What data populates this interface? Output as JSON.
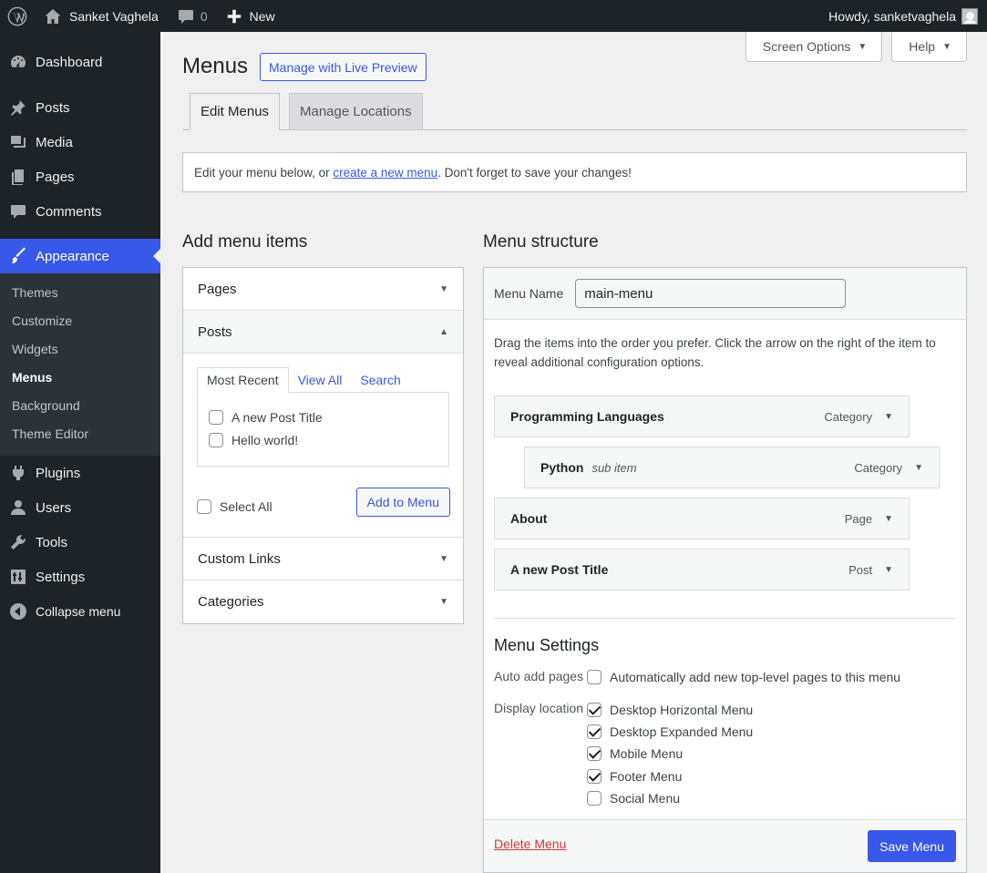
{
  "admin_bar": {
    "site_name": "Sanket Vaghela",
    "comments_count": "0",
    "new_label": "New",
    "greeting": "Howdy, sanketvaghela"
  },
  "sidebar": {
    "items": [
      {
        "label": "Dashboard",
        "icon": "dashboard-icon"
      },
      {
        "label": "Posts",
        "icon": "pin-icon"
      },
      {
        "label": "Media",
        "icon": "media-icon"
      },
      {
        "label": "Pages",
        "icon": "pages-icon"
      },
      {
        "label": "Comments",
        "icon": "comment-icon"
      },
      {
        "label": "Appearance",
        "icon": "brush-icon"
      },
      {
        "label": "Plugins",
        "icon": "plug-icon"
      },
      {
        "label": "Users",
        "icon": "user-icon"
      },
      {
        "label": "Tools",
        "icon": "wrench-icon"
      },
      {
        "label": "Settings",
        "icon": "sliders-icon"
      },
      {
        "label": "Collapse menu",
        "icon": "collapse-icon"
      }
    ],
    "submenu": [
      "Themes",
      "Customize",
      "Widgets",
      "Menus",
      "Background",
      "Theme Editor"
    ]
  },
  "header": {
    "screen_options": "Screen Options",
    "help": "Help",
    "title": "Menus",
    "live_preview": "Manage with Live Preview",
    "tabs": [
      "Edit Menus",
      "Manage Locations"
    ]
  },
  "notice": {
    "before": "Edit your menu below, or ",
    "link": "create a new menu",
    "after": ". Don't forget to save your changes!"
  },
  "add_items": {
    "title": "Add menu items",
    "sections": [
      "Pages",
      "Posts",
      "Custom Links",
      "Categories"
    ],
    "subtabs": [
      "Most Recent",
      "View All",
      "Search"
    ],
    "posts": [
      {
        "label": "A new Post Title",
        "checked": false
      },
      {
        "label": "Hello world!",
        "checked": false
      }
    ],
    "select_all": "Select All",
    "add_button": "Add to Menu"
  },
  "structure": {
    "title": "Menu structure",
    "name_label": "Menu Name",
    "name_value": "main-menu",
    "instructions": "Drag the items into the order you prefer. Click the arrow on the right of the item to reveal additional configuration options.",
    "items": [
      {
        "title": "Programming Languages",
        "sub": "",
        "type": "Category"
      },
      {
        "title": "Python",
        "sub": "sub item",
        "type": "Category"
      },
      {
        "title": "About",
        "sub": "",
        "type": "Page"
      },
      {
        "title": "A new Post Title",
        "sub": "",
        "type": "Post"
      }
    ]
  },
  "settings": {
    "title": "Menu Settings",
    "auto_add_label": "Auto add pages",
    "auto_add_option": "Automatically add new top-level pages to this menu",
    "auto_add_checked": false,
    "display_label": "Display location",
    "locations": [
      {
        "label": "Desktop Horizontal Menu",
        "checked": true
      },
      {
        "label": "Desktop Expanded Menu",
        "checked": true
      },
      {
        "label": "Mobile Menu",
        "checked": true
      },
      {
        "label": "Footer Menu",
        "checked": true
      },
      {
        "label": "Social Menu",
        "checked": false
      }
    ]
  },
  "footer": {
    "delete": "Delete Menu",
    "save": "Save Menu"
  },
  "colors": {
    "admin_dark": "#1d2327",
    "accent": "#3858e9",
    "danger": "#d63638"
  }
}
